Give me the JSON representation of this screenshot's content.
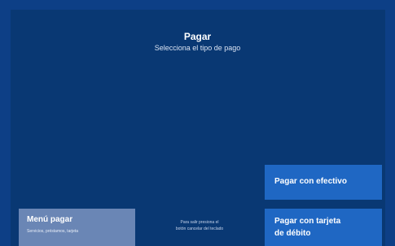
{
  "header": {
    "title": "Pagar",
    "subtitle": "Selecciona el tipo de pago"
  },
  "buttons": {
    "cash_label": "Pagar con efectivo",
    "debit_line1": "Pagar con tarjeta",
    "debit_line2": "de débito",
    "menu_label": "Menú pagar",
    "menu_sub": "Servicios, préstamos, tarjeta"
  },
  "hint": {
    "line1": "Para salir presiona el",
    "line2": "botón cancelar del teclado"
  },
  "colors": {
    "background": "#0d3f86",
    "panel": "#093873",
    "primary_button": "#1f67c3",
    "secondary_button": "#6a86b5"
  }
}
